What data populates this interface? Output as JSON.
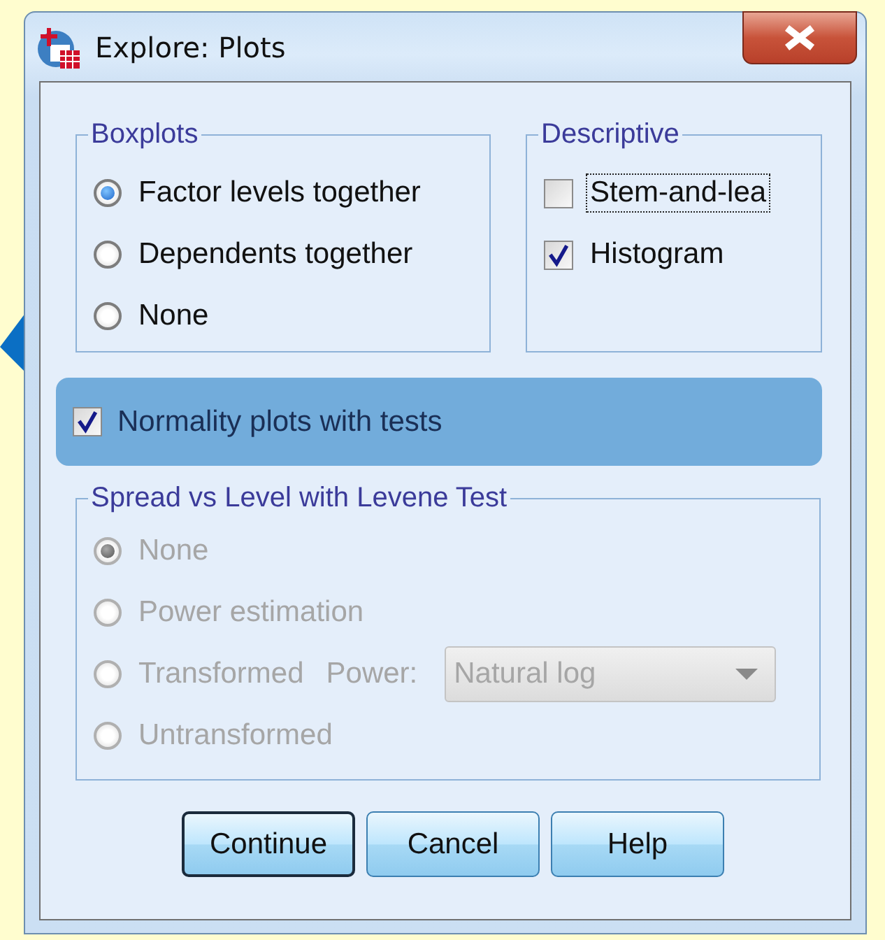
{
  "window": {
    "title": "Explore: Plots"
  },
  "boxplots": {
    "title": "Boxplots",
    "options": [
      {
        "label": "Factor levels together",
        "selected": true
      },
      {
        "label": "Dependents together",
        "selected": false
      },
      {
        "label": "None",
        "selected": false
      }
    ]
  },
  "descriptive": {
    "title": "Descriptive",
    "options": [
      {
        "label": "Stem-and-lea",
        "checked": false,
        "focused": true
      },
      {
        "label": "Histogram",
        "checked": true,
        "focused": false
      }
    ]
  },
  "normality": {
    "label": "Normality plots with tests",
    "checked": true,
    "highlighted": true
  },
  "spread": {
    "title": "Spread vs Level with Levene Test",
    "disabled": true,
    "options": [
      {
        "label": "None",
        "selected": true
      },
      {
        "label": "Power estimation",
        "selected": false
      },
      {
        "label": "Transformed",
        "selected": false,
        "power": {
          "label": "Power:",
          "value": "Natural log"
        }
      },
      {
        "label": "Untransformed",
        "selected": false
      }
    ]
  },
  "buttons": [
    {
      "label": "Continue",
      "default": true
    },
    {
      "label": "Cancel",
      "default": false
    },
    {
      "label": "Help",
      "default": false
    }
  ]
}
